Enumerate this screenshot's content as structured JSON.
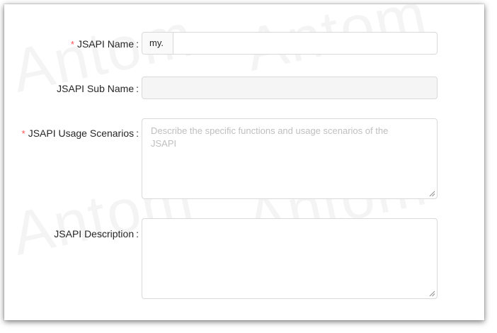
{
  "watermark": {
    "text": "Antom"
  },
  "form": {
    "jsapi_name": {
      "label": "JSAPI Name",
      "required": true,
      "prefix": "my.",
      "value": ""
    },
    "jsapi_sub_name": {
      "label": "JSAPI Sub Name",
      "required": false,
      "value": "",
      "disabled": true
    },
    "jsapi_usage_scenarios": {
      "label": "JSAPI Usage Scenarios",
      "required": true,
      "placeholder": "Describe the specific functions and usage scenarios of the JSAPI",
      "value": ""
    },
    "jsapi_description": {
      "label": "JSAPI Description",
      "required": false,
      "value": ""
    }
  },
  "colors": {
    "required_mark": "#ff4d4f",
    "border": "#d9d9d9",
    "disabled_bg": "#f5f5f5",
    "placeholder": "#bfbfbf"
  }
}
